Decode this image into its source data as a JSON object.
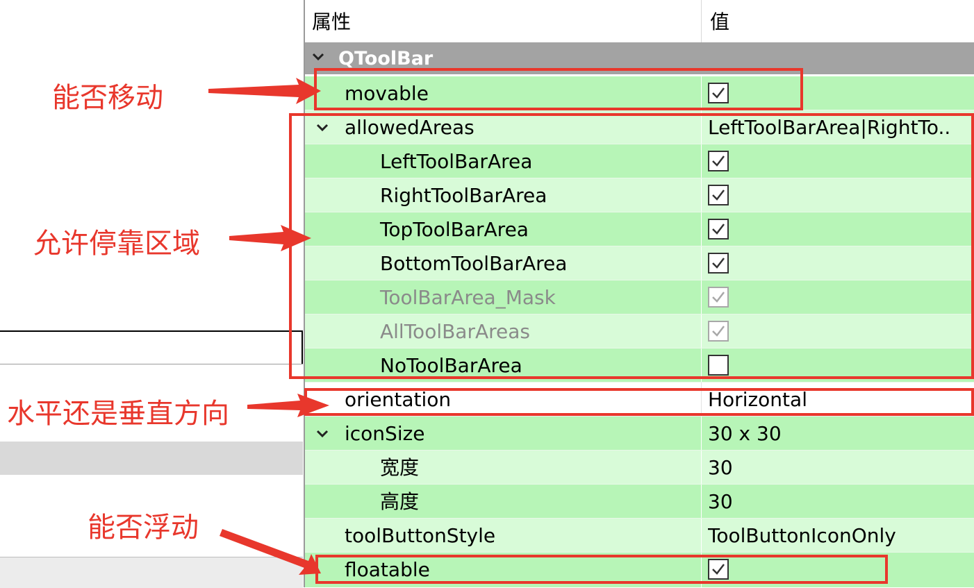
{
  "header": {
    "col_property": "属性",
    "col_value": "值"
  },
  "section": {
    "title": "QToolBar"
  },
  "rows": [
    {
      "name": "movable",
      "value_type": "checkbox",
      "checked": true
    },
    {
      "name": "allowedAreas",
      "value": "LeftToolBarArea|RightTo..",
      "expandable": true
    },
    {
      "name": "LeftToolBarArea",
      "value_type": "checkbox",
      "checked": true
    },
    {
      "name": "RightToolBarArea",
      "value_type": "checkbox",
      "checked": true
    },
    {
      "name": "TopToolBarArea",
      "value_type": "checkbox",
      "checked": true
    },
    {
      "name": "BottomToolBarArea",
      "value_type": "checkbox",
      "checked": true
    },
    {
      "name": "ToolBarArea_Mask",
      "value_type": "checkbox",
      "checked": true,
      "disabled": true
    },
    {
      "name": "AllToolBarAreas",
      "value_type": "checkbox",
      "checked": true,
      "disabled": true
    },
    {
      "name": "NoToolBarArea",
      "value_type": "checkbox",
      "checked": false
    },
    {
      "name": "orientation",
      "value": "Horizontal"
    },
    {
      "name": "iconSize",
      "value": "30 x 30",
      "expandable": true
    },
    {
      "name": "宽度",
      "value": "30"
    },
    {
      "name": "高度",
      "value": "30"
    },
    {
      "name": "toolButtonStyle",
      "value": "ToolButtonIconOnly"
    },
    {
      "name": "floatable",
      "value_type": "checkbox",
      "checked": true
    }
  ],
  "annotations": {
    "movable": "能否移动",
    "allowed_areas": "允许停靠区域",
    "orientation": "水平还是垂直方向",
    "floatable": "能否浮动"
  },
  "colors": {
    "annotation_red": "#e8372c",
    "row_green_dark": "#b7f5b7",
    "row_green_light": "#d8fbd8",
    "section_gray": "#a3a3a3"
  }
}
